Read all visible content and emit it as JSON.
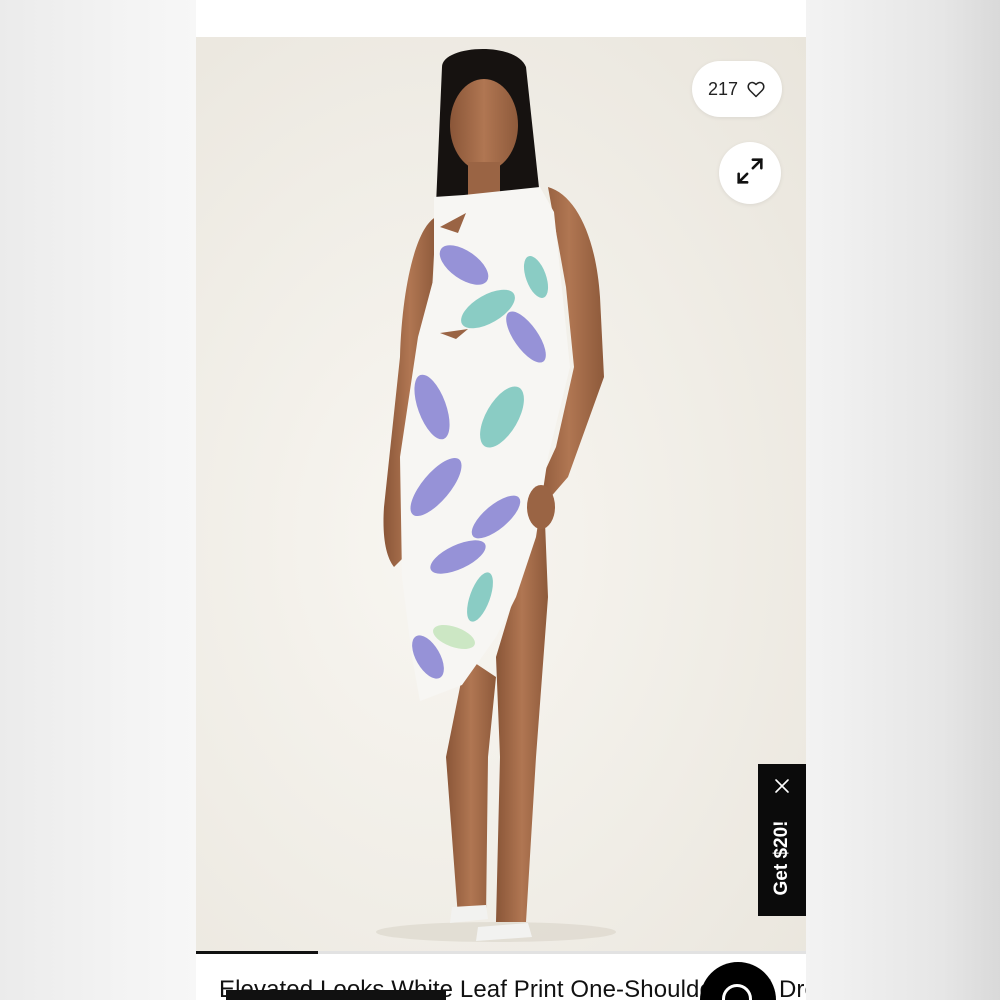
{
  "product": {
    "title": "Elevated Looks White Leaf Print One-Shoulder Midi Dress",
    "image_alt": "Model wearing white leaf print one-shoulder midi dress"
  },
  "likes": {
    "count": "217",
    "icon": "heart-outline-icon"
  },
  "expand": {
    "icon": "expand-arrows-icon"
  },
  "promo": {
    "label": "Get $20!",
    "close_icon": "close-icon"
  },
  "gallery": {
    "progress": 0.2
  },
  "chat": {
    "icon": "chat-icon"
  },
  "colors": {
    "promo_bg": "#0b0b0b",
    "image_bg": "#f0ede6",
    "leaf_purple": "#8c88d4",
    "leaf_teal": "#7fc8c0"
  }
}
